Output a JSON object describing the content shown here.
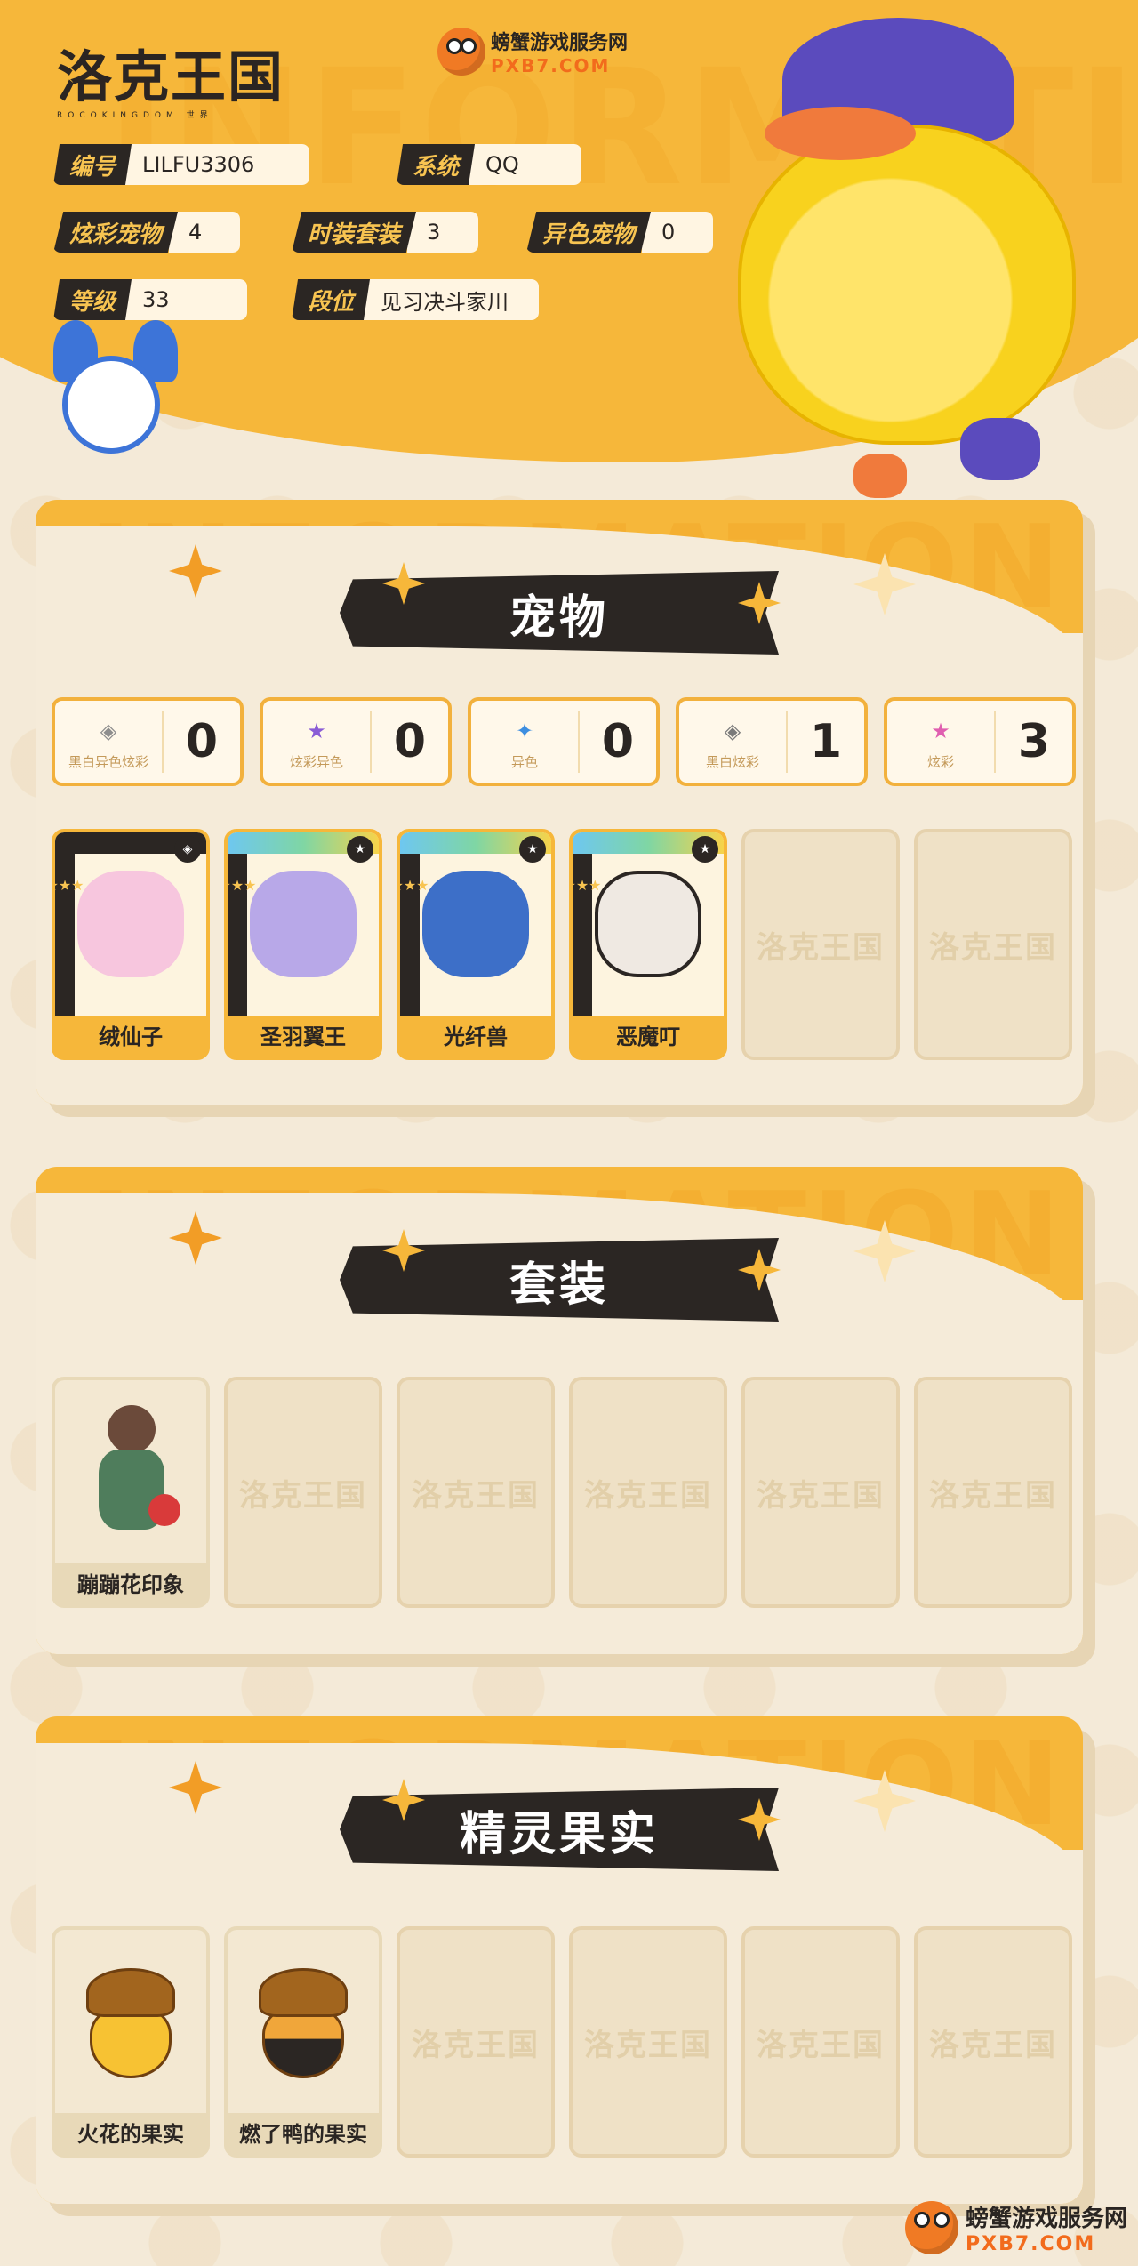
{
  "header": {
    "logo_text": "洛克王国",
    "logo_sub": "ROCOKINGDOM 世界",
    "watermark": "INFORMATION",
    "site_name": "螃蟹游戏服务网",
    "site_url": "PXB7.COM",
    "chips": [
      {
        "label": "编号",
        "value": "LILFU3306"
      },
      {
        "label": "系统",
        "value": "QQ"
      },
      {
        "label": "炫彩宠物",
        "value": "4"
      },
      {
        "label": "时装套装",
        "value": "3"
      },
      {
        "label": "异色宠物",
        "value": "0"
      },
      {
        "label": "等级",
        "value": "33"
      },
      {
        "label": "段位",
        "value": "见习决斗家川"
      }
    ]
  },
  "pets": {
    "title": "宠物",
    "watermark": "INFORMATION",
    "stats": [
      {
        "icon": "◈",
        "label": "黑白异色炫彩",
        "value": "0",
        "icon_color": "#8d8d8d"
      },
      {
        "icon": "★",
        "label": "炫彩异色",
        "value": "0",
        "icon_color": "#8a5cd6"
      },
      {
        "icon": "✦",
        "label": "异色",
        "value": "0",
        "icon_color": "#3d8ee0"
      },
      {
        "icon": "◈",
        "label": "黑白炫彩",
        "value": "1",
        "icon_color": "#7a7a7a"
      },
      {
        "icon": "★",
        "label": "炫彩",
        "value": "3",
        "icon_color": "#e05fb0"
      }
    ],
    "cards": [
      {
        "name": "绒仙子",
        "stripe": "dark",
        "art_color": "#f7c6de"
      },
      {
        "name": "圣羽翼王",
        "stripe": "rainbow",
        "art_color": "#b8a8e8"
      },
      {
        "name": "光纤兽",
        "stripe": "rainbow",
        "art_color": "#3d6fc8"
      },
      {
        "name": "恶魔叮",
        "stripe": "rainbow",
        "art_color": "#efe9e2"
      }
    ],
    "empty_mark": "洛克王国"
  },
  "outfits": {
    "title": "套装",
    "watermark": "INFORMATION",
    "cards": [
      {
        "name": "蹦蹦花印象"
      }
    ],
    "empty_mark": "洛克王国"
  },
  "fruits": {
    "title": "精灵果实",
    "watermark": "INFORMATION",
    "cards": [
      {
        "name": "火花的果实",
        "body_color": "#f7c233",
        "accent": "#e8821c"
      },
      {
        "name": "燃了鸭的果实",
        "body_color": "#f0a63a",
        "accent": "#2b2623"
      }
    ],
    "empty_mark": "洛克王国"
  },
  "footer": {
    "site_name": "螃蟹游戏服务网",
    "site_url": "PXB7.COM"
  }
}
